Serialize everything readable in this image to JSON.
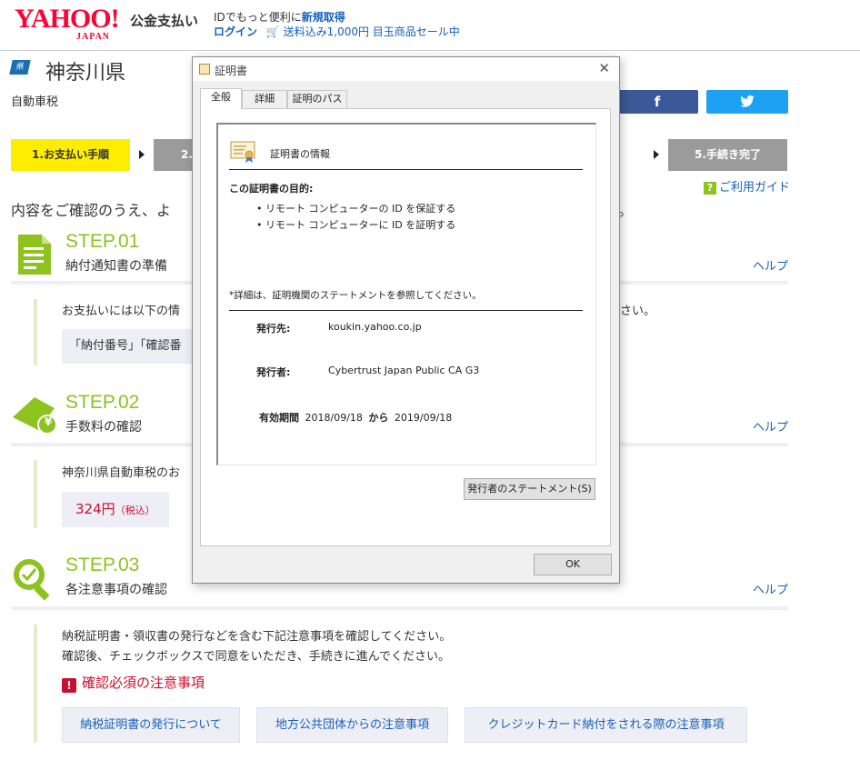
{
  "header": {
    "logo_text": "YAHOO!",
    "logo_sub": "JAPAN",
    "service_name": "公金支払い",
    "promo_line1_prefix": "IDでもっと便利に",
    "promo_line1_link": "新規取得",
    "login_link": "ログイン",
    "cart_icon": "cart-icon",
    "sale_text": "送料込み1,000円 目玉商品セール中"
  },
  "page": {
    "pref_icon_text": "県",
    "title": "神奈川県",
    "tax_name": "自動車税",
    "facebook_label": "f",
    "twitter_label": "🐦",
    "intro_left": "内容をご確認のうえ、よ",
    "intro_right": "。",
    "guide_icon": "?",
    "guide_label": "ご利用ガイド"
  },
  "steps_bar": {
    "step1": "1.お支払い手順",
    "step2": "2.",
    "step5": "5.手続き完了"
  },
  "step01": {
    "num": "STEP.01",
    "label": "納付通知書の準備",
    "help": "ヘルプ",
    "text_left": "お支払いには以下の情",
    "text_right": "さい。",
    "box": "「納付番号」「確認番"
  },
  "step02": {
    "num": "STEP.02",
    "label": "手数料の確認",
    "help": "ヘルプ",
    "yen_symbol": "¥",
    "text": "神奈川県自動車税のお",
    "fee": "324円",
    "fee_note": "（税込）"
  },
  "step03": {
    "num": "STEP.03",
    "label": "各注意事項の確認",
    "help": "ヘルプ",
    "line1": "納税証明書・領収書の発行などを含む下記注意事項を確認してください。",
    "line2": "確認後、チェックボックスで同意をいただき、手続きに進んでください。",
    "warn_icon": "!",
    "warning": "確認必須の注意事項",
    "links": [
      "納税証明書の発行について",
      "地方公共団体からの注意事項",
      "クレジットカード納付をされる際の注意事項"
    ]
  },
  "dialog": {
    "title": "証明書",
    "close": "✕",
    "tabs": [
      "全般",
      "詳細",
      "証明のパス"
    ],
    "heading": "証明書の情報",
    "purpose_title": "この証明書の目的:",
    "purposes": [
      "• リモート コンピューターの ID を保証する",
      "• リモート コンピューターに ID を証明する"
    ],
    "note": "*詳細は、証明機関のステートメントを参照してください。",
    "issued_to_label": "発行先:",
    "issued_to": "koukin.yahoo.co.jp",
    "issued_by_label": "発行者:",
    "issued_by": "Cybertrust Japan Public CA G3",
    "validity_label": "有効期間",
    "valid_from": "2018/09/18",
    "valid_from_to": "から",
    "valid_to": "2019/09/18",
    "statement_button": "発行者のステートメント(S)",
    "ok_button": "OK"
  },
  "colors": {
    "accent_green": "#8dc21f",
    "link_blue": "#1560bd",
    "yahoo_red": "#ff0033",
    "step_yellow": "#ffed00",
    "warning_red": "#c8102e"
  }
}
